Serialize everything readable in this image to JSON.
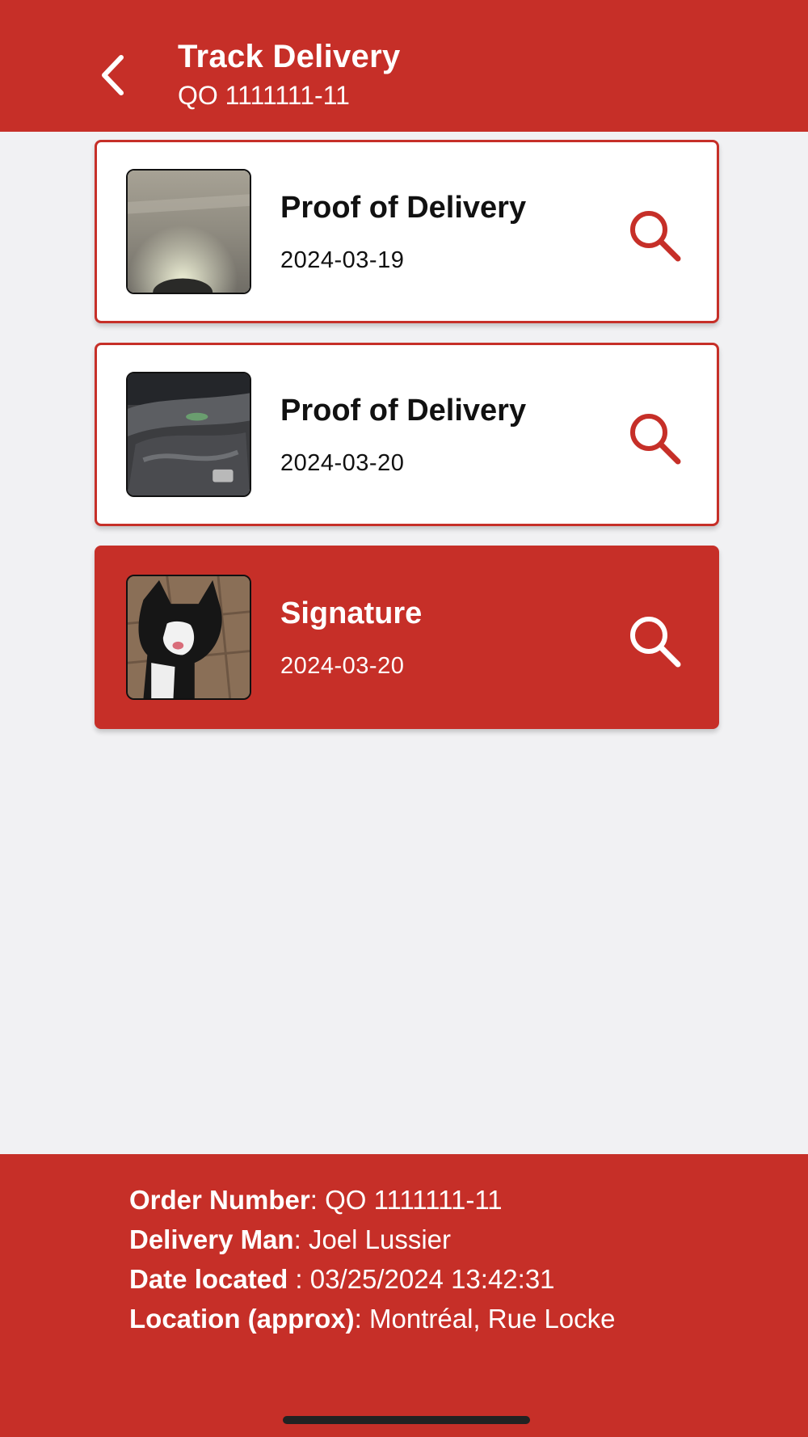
{
  "header": {
    "title": "Track Delivery",
    "subtitle": "QO 1111111-11",
    "back_icon": "chevron-left-icon"
  },
  "deliveries": [
    {
      "title": "Proof of Delivery",
      "date": "2024-03-19",
      "icon": "search-icon",
      "selected": false
    },
    {
      "title": "Proof of Delivery",
      "date": "2024-03-20",
      "icon": "search-icon",
      "selected": false
    },
    {
      "title": "Signature",
      "date": "2024-03-20",
      "icon": "search-icon",
      "selected": true
    }
  ],
  "footer": {
    "order_number": {
      "label": "Order Number",
      "sep": ": ",
      "value": "QO 1111111-11"
    },
    "delivery_man": {
      "label": "Delivery Man",
      "sep": ": ",
      "value": "Joel Lussier"
    },
    "date_located": {
      "label": "Date located",
      "sep": " : ",
      "value": "03/25/2024 13:42:31"
    },
    "location": {
      "label": "Location (approx)",
      "sep": ": ",
      "value": "Montréal, Rue Locke"
    }
  },
  "colors": {
    "accent": "#c62f28",
    "background": "#f1f1f3",
    "card": "#ffffff"
  }
}
